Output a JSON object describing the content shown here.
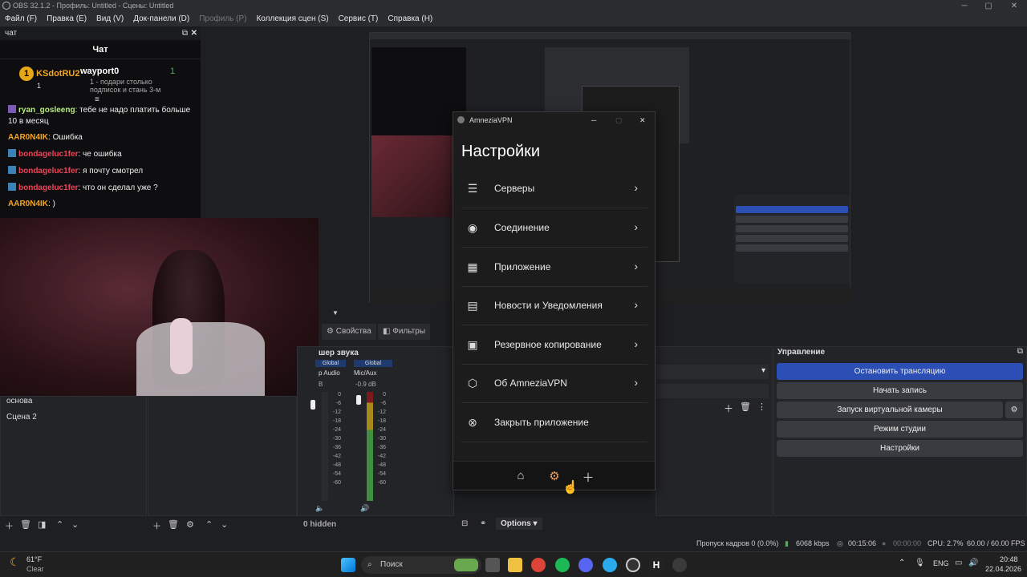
{
  "window": {
    "title": "OBS 32.1.2 - Профиль: Untitled - Сцены: Untitled"
  },
  "menu": [
    "Файл (F)",
    "Правка (E)",
    "Вид (V)",
    "Док-панели (D)",
    "Профиль (P)",
    "Коллекция сцен (S)",
    "Сервис (T)",
    "Справка (H)"
  ],
  "chat": {
    "dock_title": "чат",
    "title": "Чат",
    "gift1": {
      "user": "KSdotRU2",
      "count": "1"
    },
    "gift2": {
      "user": "wayport0",
      "count": "1",
      "text": "1 - подари столько подписок и стань 3-м"
    },
    "messages": [
      {
        "user": "ryan_gosleeng",
        "text": "тебе не надо платить больше 10 в месяц",
        "color": "#b8e986"
      },
      {
        "user": "AAR0N4IK",
        "text": "Ошибка",
        "color": "#f5a623"
      },
      {
        "user": "bondageluc1fer",
        "text": "че ошибка",
        "color": "#e8455a"
      },
      {
        "user": "bondageluc1fer",
        "text": "я почту смотрел",
        "color": "#e8455a"
      },
      {
        "user": "bondageluc1fer",
        "text": "что он сделал уже ?",
        "color": "#e8455a"
      },
      {
        "user": "AAR0N4IK",
        "text": ")",
        "color": "#f5a623"
      }
    ]
  },
  "vpn": {
    "app_title": "AmneziaVPN",
    "heading": "Настройки",
    "items": [
      {
        "label": "Серверы",
        "icon": "server-icon"
      },
      {
        "label": "Соединение",
        "icon": "connection-icon"
      },
      {
        "label": "Приложение",
        "icon": "apps-icon"
      },
      {
        "label": "Новости и Уведомления",
        "icon": "news-icon"
      },
      {
        "label": "Резервное копирование",
        "icon": "save-icon"
      },
      {
        "label": "Об AmneziaVPN",
        "icon": "amnezia-icon"
      },
      {
        "label": "Закрыть приложение",
        "icon": "close-circle-icon"
      }
    ]
  },
  "properties": {
    "props_label": "Свойства",
    "filters_label": "Фильтры"
  },
  "scenes": {
    "items": [
      "основа",
      "Сцена 2"
    ]
  },
  "mixer": {
    "title": "шер звука",
    "channels": [
      {
        "name": "Desktop Audio",
        "short": "p Audio",
        "level_db": "B"
      },
      {
        "name": "Mic/Aux",
        "short": "Mic/Aux",
        "level_db": "-0.9 dB"
      }
    ],
    "global_label": "Global",
    "scale": [
      "0",
      "-6",
      "-12",
      "-18",
      "-24",
      "-30",
      "-36",
      "-42",
      "-48",
      "-54",
      "-60"
    ],
    "hidden": "0 hidden",
    "options": "Options"
  },
  "controls": {
    "title": "Управление",
    "stop_stream": "Остановить трансляцию",
    "start_record": "Начать запись",
    "virtual_cam": "Запуск виртуальной камеры",
    "studio": "Режим студии",
    "settings": "Настройки",
    "stop_color": "#2c4fb5"
  },
  "status": {
    "dropped": "Пропуск кадров 0 (0.0%)",
    "bitrate": "6068 kbps",
    "stream_time": "00:15:06",
    "rec_time": "00:00:00",
    "cpu": "CPU: 2.7%",
    "fps": "60.00 / 60.00 FPS"
  },
  "taskbar": {
    "weather_temp": "61°F",
    "weather_desc": "Clear",
    "search": "Поиск",
    "lang": "ENG",
    "time": "20:48",
    "date": "22.04.2026"
  }
}
